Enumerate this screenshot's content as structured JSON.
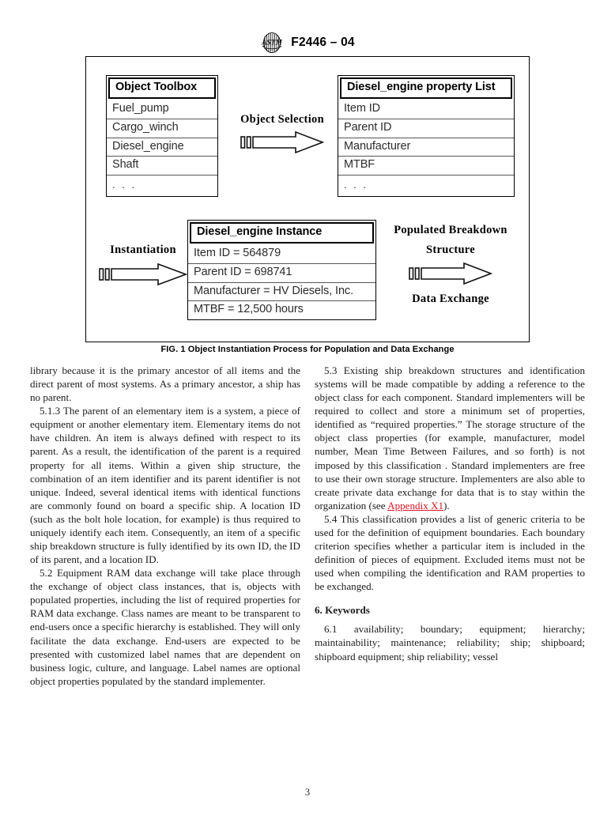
{
  "header": {
    "logo_icon": "astm-logo-icon",
    "designation": "F2446 – 04"
  },
  "figure": {
    "caption": "FIG. 1 Object Instantiation Process for Population and Data Exchange",
    "boxes": [
      {
        "id": "object-toolbox",
        "title": "Object Toolbox",
        "rows": [
          "Fuel_pump",
          "Cargo_winch",
          "Diesel_engine",
          "Shaft",
          ". . ."
        ]
      },
      {
        "id": "diesel-engine-property-list",
        "title": "Diesel_engine property List",
        "rows": [
          "Item ID",
          "Parent ID",
          "Manufacturer",
          "MTBF",
          ". . ."
        ]
      },
      {
        "id": "diesel-engine-instance",
        "title": "Diesel_engine Instance",
        "rows": [
          "Item ID = 564879",
          "Parent ID = 698741",
          "Manufacturer = HV Diesels, Inc.",
          "MTBF = 12,500 hours"
        ]
      }
    ],
    "flows": [
      {
        "id": "object-selection",
        "label": "Object Selection",
        "icon": "block-arrow-right-icon"
      },
      {
        "id": "instantiation",
        "label": "Instantiation",
        "icon": "block-arrow-right-icon"
      },
      {
        "id": "populated-breakdown",
        "label_line1": "Populated Breakdown",
        "label_line2": "Structure",
        "label_below": "Data Exchange",
        "icon": "block-arrow-right-icon"
      }
    ]
  },
  "body": {
    "left_column": {
      "para_continued": "library because it is the primary ancestor of all items and the direct parent of most systems. As a primary ancestor, a ship has no parent.",
      "para_5_1_3": "5.1.3  The parent of an elementary item is a system, a piece of equipment or another elementary item. Elementary items do not have children. An item is always defined with respect to its parent. As a result, the identification of the parent is a required property for all items. Within a given ship structure, the combination of an item identifier and its parent identifier is not unique. Indeed, several identical items with identical functions are commonly found on board a specific ship. A location ID (such as the bolt hole location, for example) is thus required to uniquely identify each item. Consequently, an item of a specific ship breakdown structure is fully identified by its own ID, the ID of its parent, and a location ID.",
      "para_5_2": "5.2  Equipment RAM data exchange will take place through the exchange of object class instances, that is, objects with populated properties, including the list of required properties for RAM data exchange. Class names are meant to be transparent to end-users once a specific hierarchy is established. They will only facilitate the data exchange. End-users are expected to be presented with customized label names that are dependent on business logic, culture, and language. Label names are optional object properties populated by the standard implementer."
    },
    "right_column": {
      "para_5_3_before_link": "5.3  Existing ship breakdown structures and identification systems will be made compatible by adding a reference to the object class for each component. Standard implementers will be required to collect and store a minimum set of properties, identified as “required properties.” The storage structure of the object class properties (for example, manufacturer, model number, Mean Time Between Failures, and so forth) is not imposed by this classification . Standard implementers are free to use their own storage structure. Implementers are also able to create private data exchange for data that is to stay within the organization (see ",
      "para_5_3_link": "Appendix X1",
      "para_5_3_after_link": ").",
      "para_5_4": "5.4  This classification provides a list of generic criteria to be used for the definition of equipment boundaries. Each boundary criterion specifies whether a particular item is included in the definition of pieces of equipment. Excluded items must not be used when compiling the identification and RAM properties to be exchanged.",
      "keywords_heading": "6.  Keywords",
      "keywords_body": "6.1  availability; boundary; equipment; hierarchy; maintainability; maintenance; reliability; ship; shipboard; shipboard equipment; ship reliability; vessel"
    }
  },
  "footer": {
    "page_number": "3"
  },
  "colors": {
    "link": "#d41921",
    "text": "#1b1b1b",
    "border": "#000000"
  }
}
